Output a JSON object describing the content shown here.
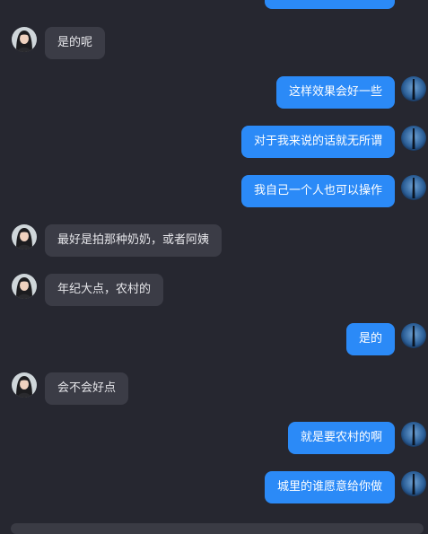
{
  "messages": [
    {
      "side": "left",
      "text": "是的呢"
    },
    {
      "side": "right",
      "text": "这样效果会好一些"
    },
    {
      "side": "right",
      "text": "对于我来说的话就无所谓"
    },
    {
      "side": "right",
      "text": "我自己一个人也可以操作"
    },
    {
      "side": "left",
      "text": "最好是拍那种奶奶，或者阿姨"
    },
    {
      "side": "left",
      "text": "年纪大点，农村的"
    },
    {
      "side": "right",
      "text": "是的"
    },
    {
      "side": "left",
      "text": "会不会好点"
    },
    {
      "side": "right",
      "text": "就是要农村的啊"
    },
    {
      "side": "right",
      "text": "城里的谁愿意给你做"
    }
  ],
  "colors": {
    "background": "#262730",
    "outgoing_bubble": "#2b8af7",
    "incoming_bubble": "#3b3c46"
  },
  "icons": {
    "contact_avatar": "woman-portrait-avatar",
    "self_avatar": "blue-dark-avatar"
  }
}
